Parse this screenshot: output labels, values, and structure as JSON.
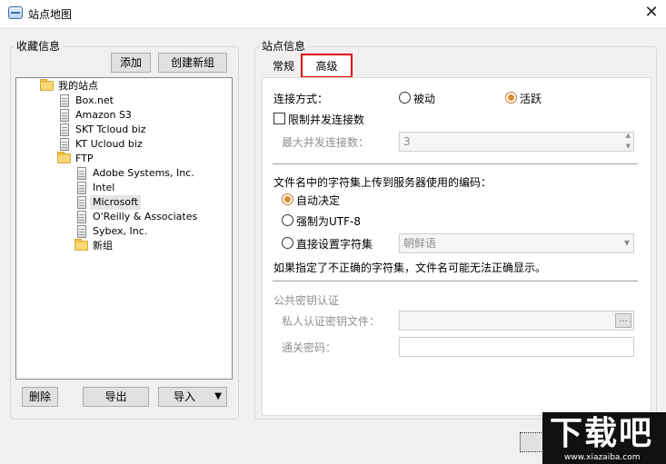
{
  "window": {
    "title": "站点地图",
    "close_glyph": "✕"
  },
  "left": {
    "group_label": "收藏信息",
    "add_button": "添加",
    "new_group_button": "创建新组",
    "tree": {
      "root": "我的站点",
      "sites": [
        "Box.net",
        "Amazon S3",
        "SKT Tcloud biz",
        "KT Ucloud biz"
      ],
      "ftp_folder": "FTP",
      "ftp_sites": [
        "Adobe Systems, Inc.",
        "Intel",
        "Microsoft",
        "O'Reilly & Associates",
        "Sybex, Inc."
      ],
      "ftp_subfolder": "新组",
      "selected": "Microsoft"
    },
    "delete_button": "删除",
    "export_button": "导出",
    "import_button": "导入",
    "import_arrow": "▼"
  },
  "right": {
    "group_label": "站点信息",
    "tabs": [
      "常规",
      "高级"
    ],
    "active_tab": "高级",
    "connection_mode_label": "连接方式：",
    "mode_passive": "被动",
    "mode_active": "活跃",
    "limit_concurrent_label": "限制并发连接数",
    "max_concurrent_label": "最大并发连接数：",
    "max_concurrent_value": "3",
    "charset_heading": "文件名中的字符集上传到服务器使用的编码：",
    "charset_auto": "自动决定",
    "charset_utf8": "强制为UTF-8",
    "charset_custom": "直接设置字符集",
    "charset_select_value": "朝鲜语",
    "charset_warning": "如果指定了不正确的字符集，文件名可能无法正确显示。",
    "pubkey_heading": "公共密钥认证",
    "private_key_label": "私人认证密钥文件：",
    "browse_glyph": "...",
    "passphrase_label": "通关密码："
  },
  "colors": {
    "tab_highlight": "#e00000",
    "accent_radio": "#e08a20"
  },
  "watermark": {
    "big": "下载吧",
    "small": "www.xiazaiba.com"
  }
}
